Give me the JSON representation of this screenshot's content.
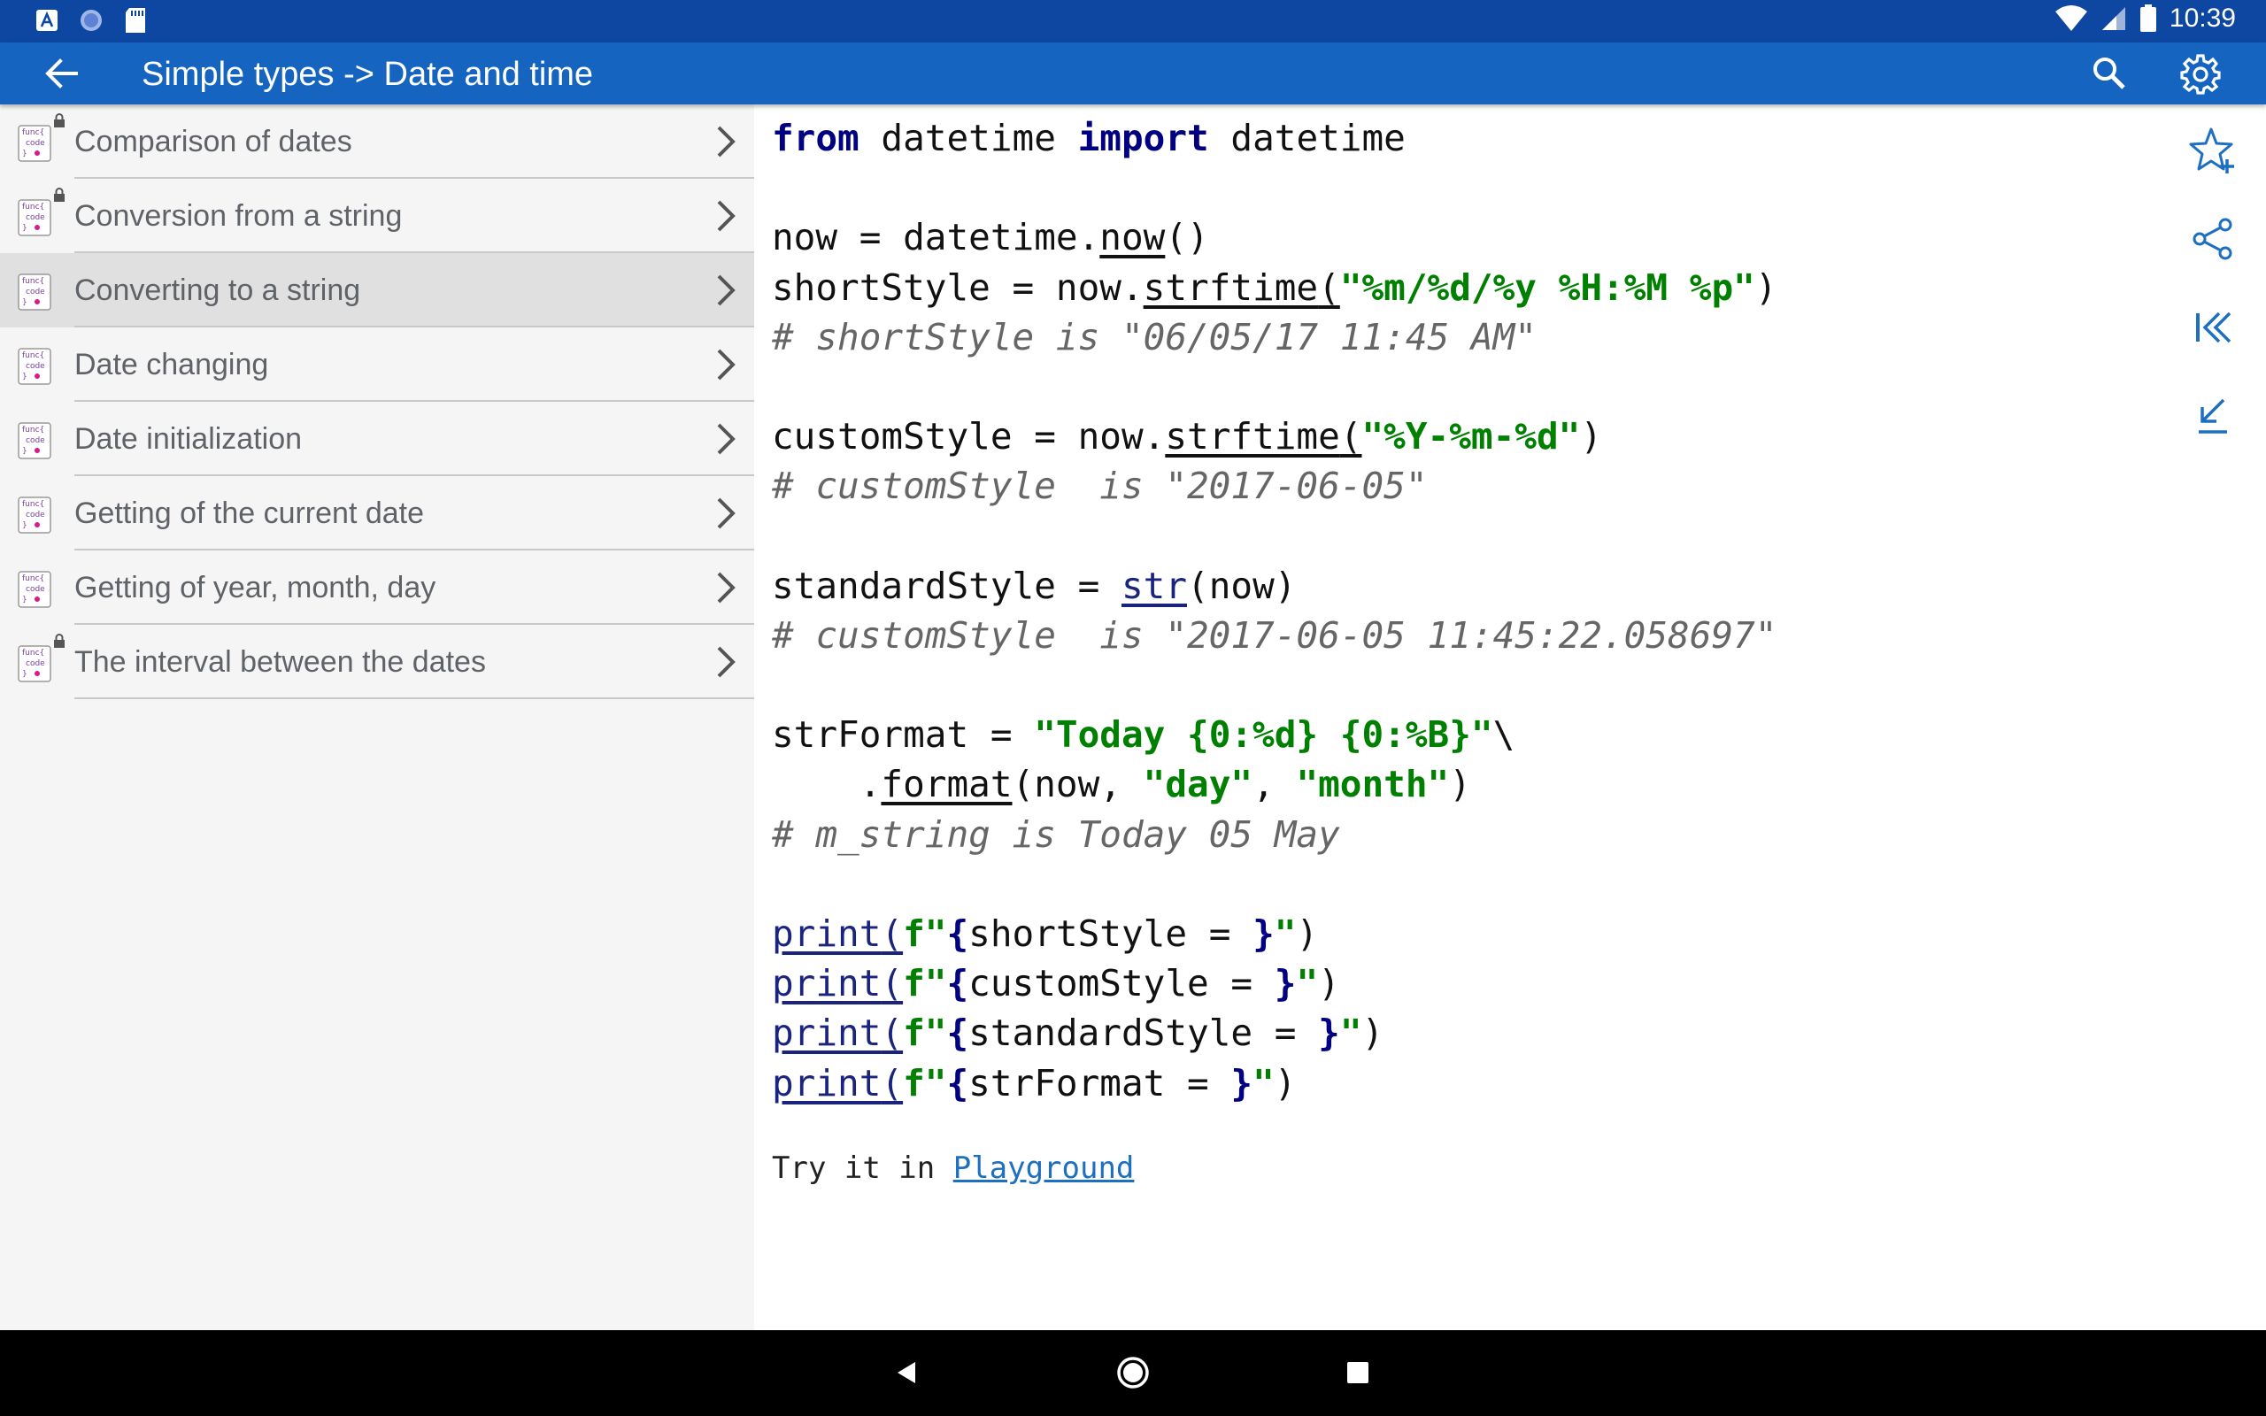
{
  "status": {
    "time": "10:39"
  },
  "app_bar": {
    "title": "Simple types -> Date and time"
  },
  "sidebar": {
    "items": [
      {
        "label": "Comparison of dates",
        "locked": true,
        "selected": false
      },
      {
        "label": "Conversion from a string",
        "locked": true,
        "selected": false
      },
      {
        "label": "Converting to a string",
        "locked": false,
        "selected": true
      },
      {
        "label": "Date changing",
        "locked": false,
        "selected": false
      },
      {
        "label": "Date initialization",
        "locked": false,
        "selected": false
      },
      {
        "label": "Getting of the current date",
        "locked": false,
        "selected": false
      },
      {
        "label": "Getting of year, month, day",
        "locked": false,
        "selected": false
      },
      {
        "label": "The interval between the dates",
        "locked": true,
        "selected": false
      }
    ],
    "icon_lines": [
      "func{",
      "code",
      "}"
    ]
  },
  "code": {
    "l1": {
      "from": "from",
      "datetime_mod": " datetime ",
      "import": "import",
      "datetime_cls": " datetime"
    },
    "l3": {
      "pre": "now = datetime.",
      "fn": "now",
      "post": "()"
    },
    "l4": {
      "pre": "shortStyle = now.",
      "fn": "strftime",
      "open": "(",
      "str": "\"%m/%d/%y %H:%M %p\"",
      "close": ")"
    },
    "l5": {
      "comment": "# shortStyle is \"06/05/17 11:45 AM\""
    },
    "l7": {
      "pre": "customStyle = now.",
      "fn": "strftime",
      "open": "(",
      "str": "\"%Y-%m-%d\"",
      "close": ")"
    },
    "l8": {
      "comment": "# customStyle  is \"2017-06-05\""
    },
    "l10": {
      "pre": "standardStyle = ",
      "fn": "str",
      "post": "(now)"
    },
    "l11": {
      "comment": "# customStyle  is \"2017-06-05 11:45:22.058697\""
    },
    "l13": {
      "pre": "strFormat = ",
      "str": "\"Today {0:%d} {0:%B}\"",
      "post": "\\"
    },
    "l14": {
      "pre": "    .",
      "fn": "format",
      "mid": "(now, ",
      "s1": "\"day\"",
      "comma": ", ",
      "s2": "\"month\"",
      "close": ")"
    },
    "l15": {
      "comment": "# m_string is Today 05 May"
    },
    "prints": [
      {
        "fn": "print",
        "open": "(",
        "f": "f\"",
        "ob": "{",
        "expr": "shortStyle = ",
        "cb": "}",
        "q": "\"",
        "close": ")"
      },
      {
        "fn": "print",
        "open": "(",
        "f": "f\"",
        "ob": "{",
        "expr": "customStyle = ",
        "cb": "}",
        "q": "\"",
        "close": ")"
      },
      {
        "fn": "print",
        "open": "(",
        "f": "f\"",
        "ob": "{",
        "expr": "standardStyle = ",
        "cb": "}",
        "q": "\"",
        "close": ")"
      },
      {
        "fn": "print",
        "open": "(",
        "f": "f\"",
        "ob": "{",
        "expr": "strFormat = ",
        "cb": "}",
        "q": "\"",
        "close": ")"
      }
    ]
  },
  "try_it": {
    "text": "Try it in ",
    "link": "Playground"
  },
  "colors": {
    "status_bar": "#0d47a1",
    "app_bar": "#1565c0",
    "accent": "#1e6fbf",
    "keyword": "#000080",
    "string": "#008000",
    "comment": "#666666"
  },
  "icons": {
    "back": "arrow-left-icon",
    "search": "search-icon",
    "settings": "gear-icon",
    "favorite": "star-plus-icon",
    "share": "share-icon",
    "first": "skip-to-first-icon",
    "download": "download-arrow-icon"
  }
}
